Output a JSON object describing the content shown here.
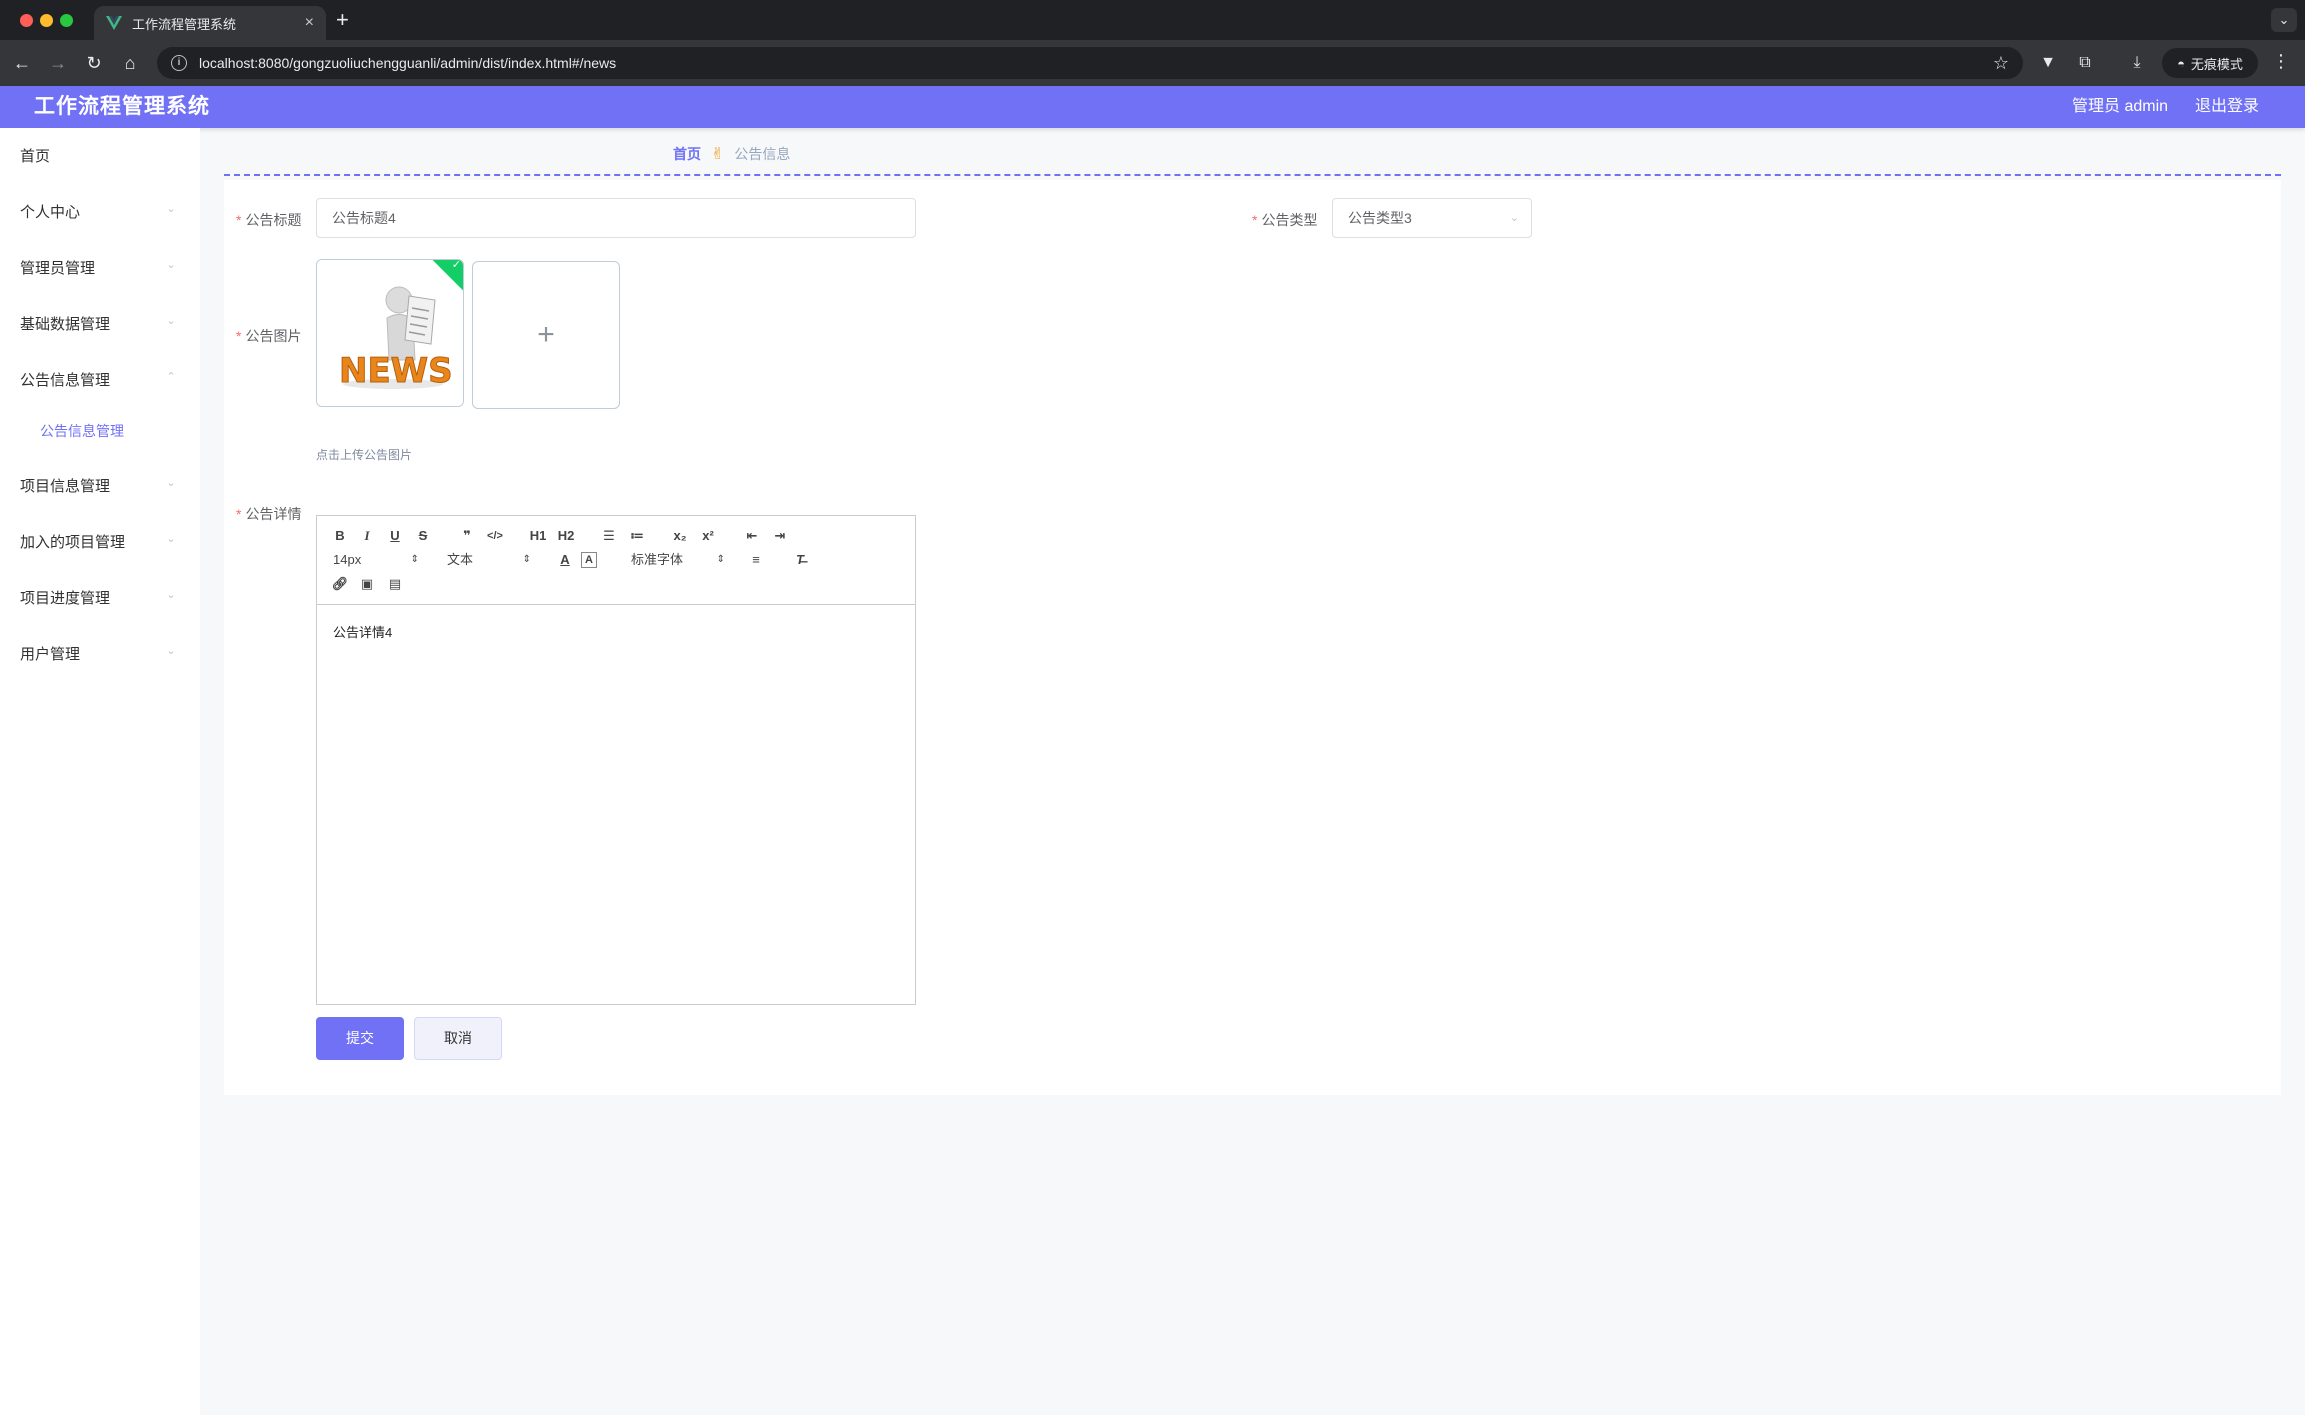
{
  "browser": {
    "tab_title": "工作流程管理系统",
    "url": "localhost:8080/gongzuoliuchengguanli/admin/dist/index.html#/news",
    "incognito_label": "无痕模式"
  },
  "header": {
    "title": "工作流程管理系统",
    "user": "管理员 admin",
    "logout": "退出登录"
  },
  "sidebar": {
    "items": [
      {
        "label": "首页"
      },
      {
        "label": "个人中心"
      },
      {
        "label": "管理员管理"
      },
      {
        "label": "基础数据管理"
      },
      {
        "label": "公告信息管理"
      },
      {
        "label": "公告信息管理"
      },
      {
        "label": "项目信息管理"
      },
      {
        "label": "加入的项目管理"
      },
      {
        "label": "项目进度管理"
      },
      {
        "label": "用户管理"
      }
    ]
  },
  "breadcrumb": {
    "home": "首页",
    "separator": "✌",
    "current": "公告信息"
  },
  "form": {
    "title_label": "公告标题",
    "title_value": "公告标题4",
    "type_label": "公告类型",
    "type_value": "公告类型3",
    "image_label": "公告图片",
    "upload_tip": "点击上传公告图片",
    "detail_label": "公告详情",
    "detail_value": "公告详情4",
    "submit": "提交",
    "cancel": "取消"
  },
  "editor_toolbar": {
    "size": "14px",
    "header": "文本",
    "font": "标准字体",
    "h1": "H1",
    "h2": "H2"
  },
  "thumbnail": {
    "text": "NEWS"
  },
  "colors": {
    "accent": "#7071f5",
    "success": "#13ce66",
    "required": "#f56c6c"
  }
}
